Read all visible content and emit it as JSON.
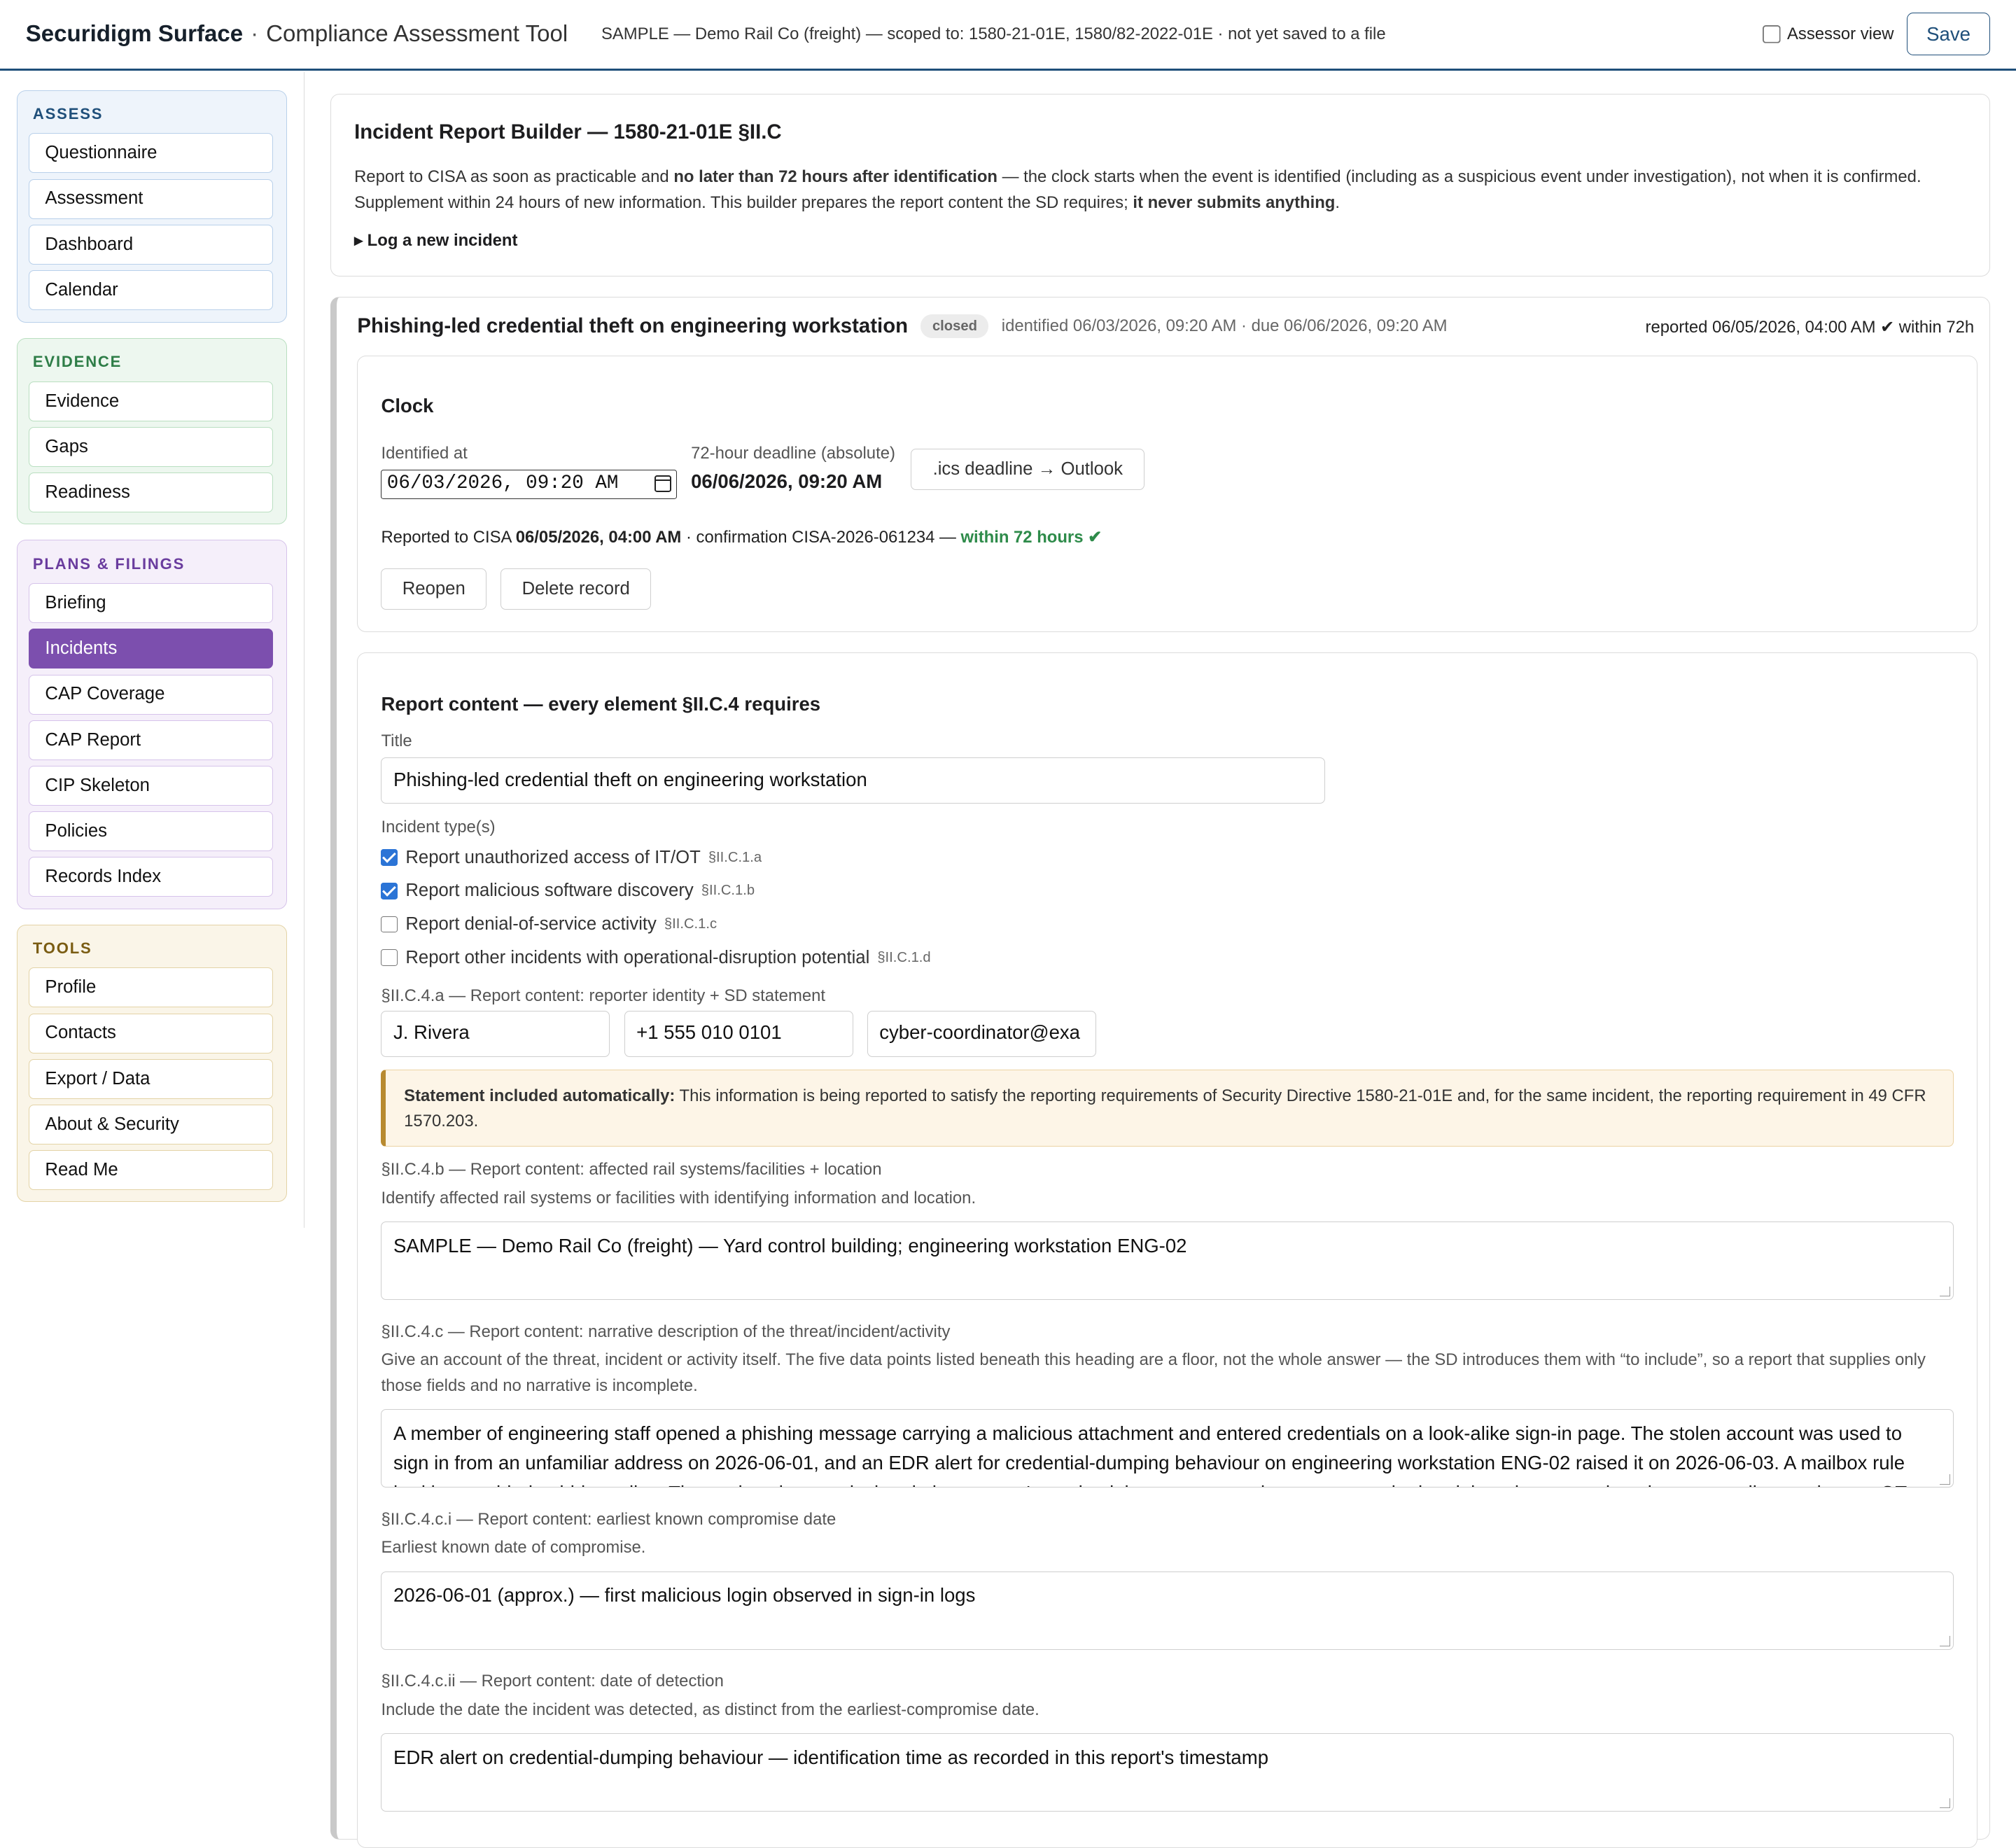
{
  "header": {
    "brand": "Securidigm Surface",
    "separator": "·",
    "subtitle": "Compliance Assessment Tool",
    "scope": "SAMPLE — Demo Rail Co (freight) — scoped to: 1580-21-01E, 1580/82-2022-01E · not yet saved to a file",
    "assessor_label": "Assessor view",
    "save_label": "Save"
  },
  "sidebar": {
    "assess": {
      "title": "ASSESS",
      "items": [
        "Questionnaire",
        "Assessment",
        "Dashboard",
        "Calendar"
      ]
    },
    "evidence": {
      "title": "EVIDENCE",
      "items": [
        "Evidence",
        "Gaps",
        "Readiness"
      ]
    },
    "plans": {
      "title": "PLANS & FILINGS",
      "items": [
        "Briefing",
        "Incidents",
        "CAP Coverage",
        "CAP Report",
        "CIP Skeleton",
        "Policies",
        "Records Index"
      ],
      "active": "Incidents"
    },
    "tools": {
      "title": "TOOLS",
      "items": [
        "Profile",
        "Contacts",
        "Export / Data",
        "About & Security",
        "Read Me"
      ]
    }
  },
  "builder": {
    "title": "Incident Report Builder — 1580-21-01E §II.C",
    "p1a": "Report to CISA as soon as practicable and ",
    "p1b": "no later than 72 hours after identification",
    "p1c": " — the clock starts when the event is identified (including as a suspicious event under investigation), not when it is confirmed. Supplement within 24 hours of new information. This builder prepares the report content the SD requires; ",
    "p1d": "it never submits anything",
    "p1e": ".",
    "log_link": "▸ Log a new incident"
  },
  "incident": {
    "title": "Phishing-led credential theft on engineering workstation",
    "status": "closed",
    "meta": "identified 06/03/2026, 09:20 AM · due 06/06/2026, 09:20 AM",
    "reported": "reported 06/05/2026, 04:00 AM ✔ within 72h",
    "clock": {
      "title": "Clock",
      "identified_label": "Identified at",
      "identified_value": "06/03/2026, 09:20 AM",
      "deadline_label": "72-hour deadline (absolute)",
      "deadline_value": "06/06/2026, 09:20 AM",
      "ics_button": ".ics deadline → Outlook",
      "reported_prefix": "Reported to CISA ",
      "reported_time": "06/05/2026, 04:00 AM",
      "reported_mid": " · confirmation CISA-2026-061234 — ",
      "reported_ok": "within 72 hours ✔",
      "reopen_button": "Reopen",
      "delete_button": "Delete record"
    },
    "content": {
      "title": "Report content — every element §II.C.4 requires",
      "title_label": "Title",
      "title_value": "Phishing-led credential theft on engineering workstation",
      "types_label": "Incident type(s)",
      "types": [
        {
          "label": "Report unauthorized access of IT/OT",
          "ref": "§II.C.1.a",
          "checked": true
        },
        {
          "label": "Report malicious software discovery",
          "ref": "§II.C.1.b",
          "checked": true
        },
        {
          "label": "Report denial-of-service activity",
          "ref": "§II.C.1.c",
          "checked": false
        },
        {
          "label": "Report other incidents with operational-disruption potential",
          "ref": "§II.C.1.d",
          "checked": false
        }
      ],
      "reporter_label": "§II.C.4.a — Report content: reporter identity + SD statement",
      "reporter_name": "J. Rivera",
      "reporter_phone": "+1 555 010 0101",
      "reporter_email": "cyber-coordinator@exa",
      "statement_bold": "Statement included automatically:",
      "statement_text": " This information is being reported to satisfy the reporting requirements of Security Directive 1580-21-01E and, for the same incident, the reporting requirement in 49 CFR 1570.203.",
      "b_label": "§II.C.4.b — Report content: affected rail systems/facilities + location",
      "b_hint": "Identify affected rail systems or facilities with identifying information and location.",
      "b_value": "SAMPLE — Demo Rail Co (freight) — Yard control building; engineering workstation ENG-02",
      "c_label": "§II.C.4.c — Report content: narrative description of the threat/incident/activity",
      "c_hint": "Give an account of the threat, incident or activity itself. The five data points listed beneath this heading are a floor, not the whole answer — the SD introduces them with “to include”, so a report that supplies only those fields and no narrative is incomplete.",
      "c_value": "A member of engineering staff opened a phishing message carrying a malicious attachment and entered credentials on a look-alike sign-in page. The stolen account was used to sign in from an unfamiliar address on 2026-06-01, and an EDR alert for credential-dumping behaviour on engineering workstation ENG-02 raised it on 2026-06-03. A mailbox rule had been added to hide replies. The workstation was isolated, the account's credentials were reset, tokens were revoked and the rule removed; no impact to rail operations or OT was observed.",
      "ci_label": "§II.C.4.c.i — Report content: earliest known compromise date",
      "ci_hint": "Earliest known date of compromise.",
      "ci_value": "2026-06-01 (approx.) — first malicious login observed in sign-in logs",
      "cii_label": "§II.C.4.c.ii — Report content: date of detection",
      "cii_hint": "Include the date the incident was detected, as distinct from the earliest-compromise date.",
      "cii_value": "EDR alert on credential-dumping behaviour — identification time as recorded in this report's timestamp"
    }
  }
}
